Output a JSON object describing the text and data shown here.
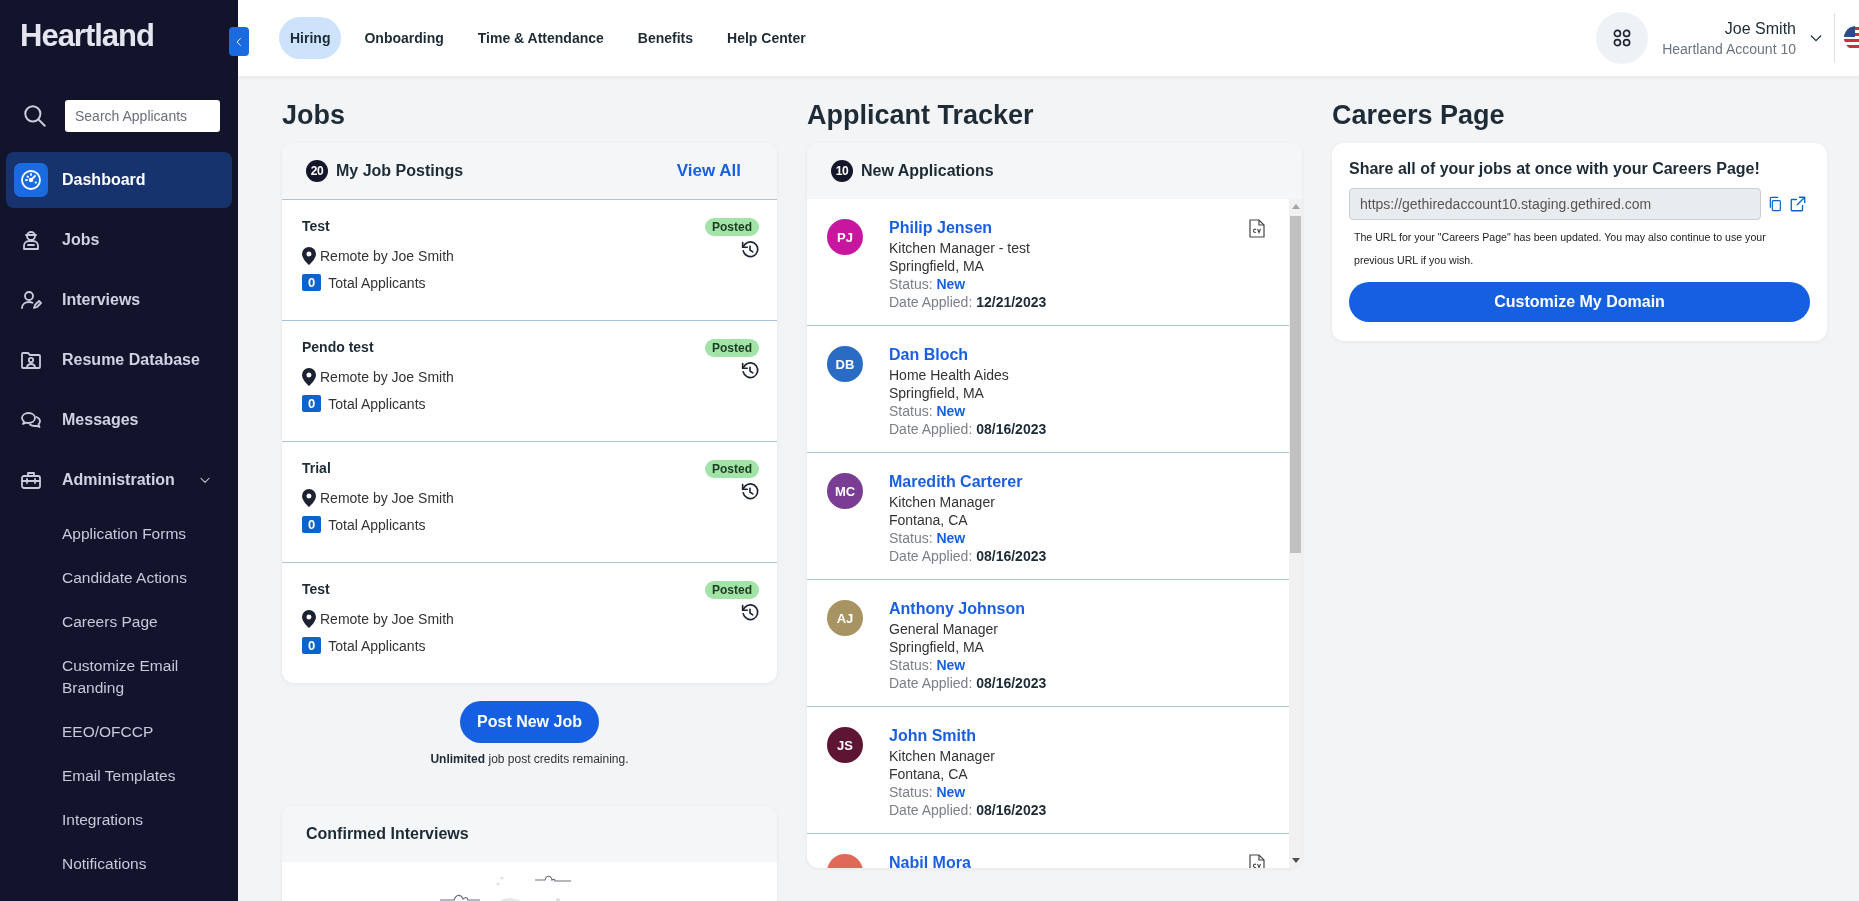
{
  "sidebar": {
    "logo": "Heartland",
    "search": {
      "placeholder": "Search Applicants"
    },
    "items": [
      {
        "label": "Dashboard",
        "selected": true
      },
      {
        "label": "Jobs",
        "selected": false
      },
      {
        "label": "Interviews",
        "selected": false
      },
      {
        "label": "Resume Database",
        "selected": false
      },
      {
        "label": "Messages",
        "selected": false
      },
      {
        "label": "Administration",
        "selected": false,
        "expanded": true,
        "children": [
          {
            "label": "Application Forms",
            "selected": false
          },
          {
            "label": "Candidate Actions",
            "selected": false
          },
          {
            "label": "Careers Page",
            "selected": false
          },
          {
            "label": "Customize Email Branding",
            "selected": false
          },
          {
            "label": "EEO/OFCCP",
            "selected": false
          },
          {
            "label": "Email Templates",
            "selected": false
          },
          {
            "label": "Integrations",
            "selected": false
          },
          {
            "label": "Notifications",
            "selected": false
          }
        ]
      }
    ]
  },
  "topbar": {
    "tabs": [
      {
        "label": "Hiring",
        "selected": true
      },
      {
        "label": "Onboarding",
        "selected": false
      },
      {
        "label": "Time & Attendance",
        "selected": false
      },
      {
        "label": "Benefits",
        "selected": false
      },
      {
        "label": "Help Center",
        "selected": false
      }
    ],
    "user": {
      "name": "Joe Smith",
      "account": "Heartland Account 10"
    }
  },
  "jobs": {
    "title": "Jobs",
    "postings": {
      "count": "20",
      "title": "My Job Postings",
      "view_all": "View All",
      "items": [
        {
          "title": "Test",
          "location": "Remote by Joe Smith",
          "applicants": "0",
          "applicants_label": "Total Applicants",
          "status": "Posted"
        },
        {
          "title": "Pendo test",
          "location": "Remote by Joe Smith",
          "applicants": "0",
          "applicants_label": "Total Applicants",
          "status": "Posted"
        },
        {
          "title": "Trial",
          "location": "Remote by Joe Smith",
          "applicants": "0",
          "applicants_label": "Total Applicants",
          "status": "Posted"
        },
        {
          "title": "Test",
          "location": "Remote by Joe Smith",
          "applicants": "0",
          "applicants_label": "Total Applicants",
          "status": "Posted"
        }
      ]
    },
    "post_button": "Post New Job",
    "credits": "**Unlimited** job post credits remaining.",
    "interviews": {
      "title": "Confirmed Interviews"
    }
  },
  "tracker": {
    "title": "Applicant Tracker",
    "count": "10",
    "subtitle": "New Applications",
    "applicants": [
      {
        "initials": "PJ",
        "color": "#c8179f",
        "name": "Philip Jensen",
        "position": "Kitchen Manager - test",
        "location": "Springfield, MA",
        "status": "Status: **New**",
        "date": "Date Applied: **12/21/2023**",
        "has_cv": true
      },
      {
        "initials": "DB",
        "color": "#2a6bc3",
        "name": "Dan Bloch",
        "position": "Home Health Aides",
        "location": "Springfield, MA",
        "status": "Status: **New**",
        "date": "Date Applied: **08/16/2023**",
        "has_cv": false
      },
      {
        "initials": "MC",
        "color": "#7b3d94",
        "name": "Maredith Carterer",
        "position": "Kitchen Manager",
        "location": "Fontana, CA",
        "status": "Status: **New**",
        "date": "Date Applied: **08/16/2023**",
        "has_cv": false
      },
      {
        "initials": "AJ",
        "color": "#a89462",
        "name": "Anthony Johnson",
        "position": "General Manager",
        "location": "Springfield, MA",
        "status": "Status: **New**",
        "date": "Date Applied: **08/16/2023**",
        "has_cv": false
      },
      {
        "initials": "JS",
        "color": "#5e1433",
        "name": "John Smith",
        "position": "Kitchen Manager",
        "location": "Fontana, CA",
        "status": "Status: **New**",
        "date": "Date Applied: **08/16/2023**",
        "has_cv": false
      },
      {
        "color": "#e0695a",
        "name": "Nabil Mora",
        "has_cv": true
      }
    ]
  },
  "careers": {
    "title": "Careers Page",
    "heading": "Share all of your jobs at once with your Careers Page!",
    "url": "https://gethiredaccount10.staging.gethired.com",
    "note": "The URL for your \"Careers Page\" has been updated. You may also continue to use your previous URL if you wish.",
    "button": "Customize My Domain"
  }
}
